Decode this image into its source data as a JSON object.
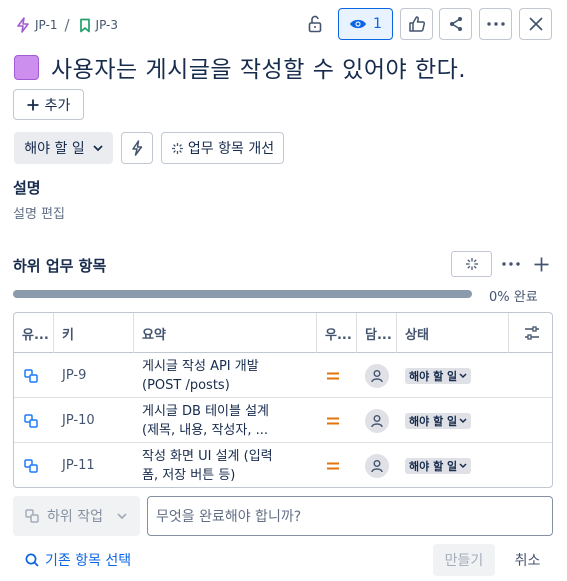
{
  "breadcrumb": {
    "parent_key": "JP-1",
    "separator": "/",
    "issue_key": "JP-3"
  },
  "header": {
    "watchers_count": "1",
    "title": "사용자는 게시글을 작성할 수 있어야 한다."
  },
  "actions": {
    "add_label": "추가",
    "status_label": "해야 할 일",
    "improve_label": "업무 항목 개선"
  },
  "description": {
    "heading": "설명",
    "edit_placeholder": "설명 편집"
  },
  "subtasks": {
    "heading": "하위 업무 항목",
    "progress_fraction": 0,
    "progress_text": "0% 완료",
    "columns": [
      "유...",
      "키",
      "요약",
      "우...",
      "담...",
      "상태"
    ],
    "rows": [
      {
        "key": "JP-9",
        "summary_line1": "게시글 작성 API 개발",
        "summary_line2": "(POST /posts)",
        "status": "해야 할 일"
      },
      {
        "key": "JP-10",
        "summary_line1": "게시글 DB 테이블 설계",
        "summary_line2": "(제목, 내용, 작성자, ...",
        "status": "해야 할 일"
      },
      {
        "key": "JP-11",
        "summary_line1": "작성 화면 UI 설계 (입력",
        "summary_line2": "폼, 저장 버튼 등)",
        "status": "해야 할 일"
      }
    ]
  },
  "create": {
    "type_label": "하위 작업",
    "input_placeholder": "무엇을 완료해야 합니까?",
    "existing_label": "기존 항목 선택",
    "create_label": "만들기",
    "cancel_label": "취소"
  },
  "colors": {
    "accent": "#0c66e4",
    "epic_purple": "#cc8fed",
    "priority_medium": "#e2740b",
    "subtask_blue": "#1d7afc"
  }
}
